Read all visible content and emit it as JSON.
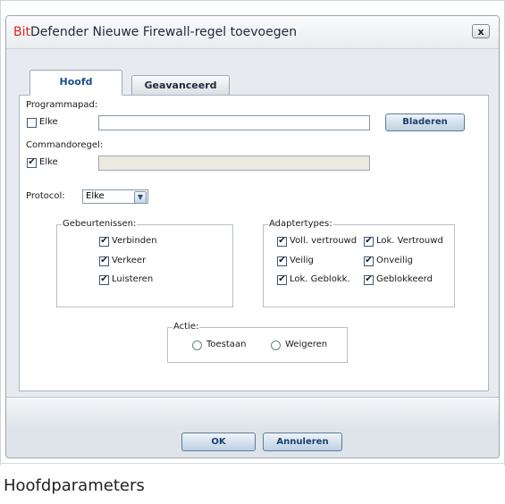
{
  "dialog": {
    "brand": "Bit",
    "title_rest": "Defender Nieuwe Firewall-regel toevoegen",
    "close_label": "x"
  },
  "tabs": [
    {
      "label": "Hoofd"
    },
    {
      "label": "Geavanceerd"
    }
  ],
  "main": {
    "programmapad_label": "Programmapad:",
    "programmapad_elke": "Elke",
    "programmapad_value": "",
    "programmapad_checked": false,
    "browse_label": "Bladeren",
    "commandoregel_label": "Commandoregel:",
    "commandoregel_elke": "Elke",
    "commandoregel_value": "",
    "commandoregel_checked": true,
    "protocol_label": "Protocol:",
    "protocol_value": "Elke",
    "gebeurtenissen": {
      "title": "Gebeurtenissen:",
      "items": [
        {
          "label": "Verbinden",
          "checked": true
        },
        {
          "label": "Verkeer",
          "checked": true
        },
        {
          "label": "Luisteren",
          "checked": true
        }
      ]
    },
    "adaptertypes": {
      "title": "Adaptertypes:",
      "items": [
        {
          "label": "Voll. vertrouwd",
          "checked": true
        },
        {
          "label": "Lok. Vertrouwd",
          "checked": true
        },
        {
          "label": "Veilig",
          "checked": true
        },
        {
          "label": "Onveilig",
          "checked": true
        },
        {
          "label": "Lok. Geblokk.",
          "checked": true
        },
        {
          "label": "Geblokkeerd",
          "checked": true
        }
      ]
    },
    "actie": {
      "title": "Actie:",
      "options": [
        {
          "label": "Toestaan",
          "selected": false
        },
        {
          "label": "Weigeren",
          "selected": false
        }
      ]
    }
  },
  "footer": {
    "ok_label": "OK",
    "cancel_label": "Annuleren"
  },
  "caption": "Hoofdparameters"
}
